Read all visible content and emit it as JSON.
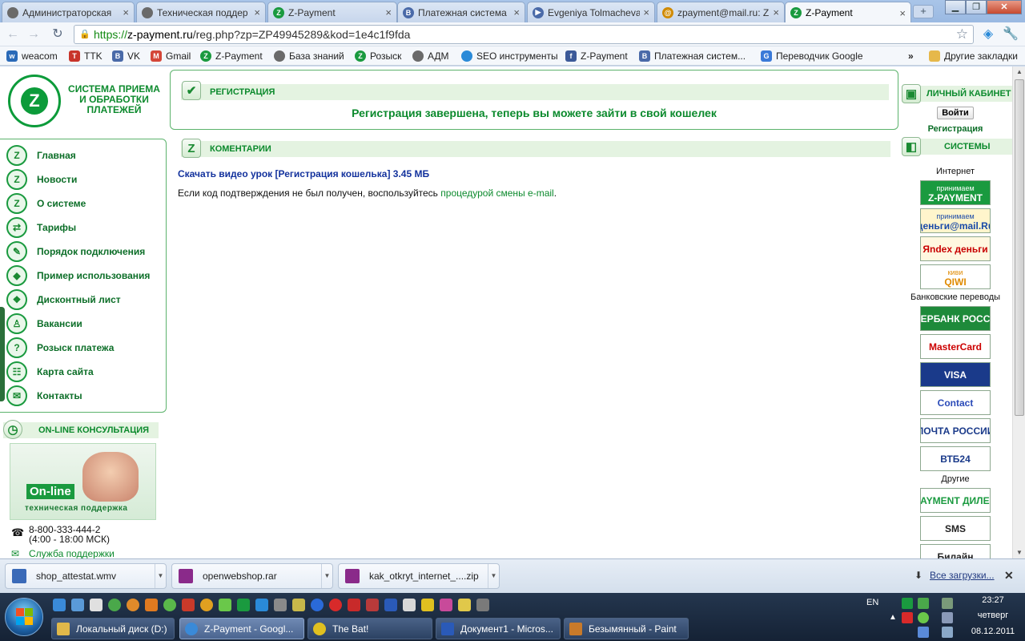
{
  "browser": {
    "tabs": [
      {
        "title": "Администраторская",
        "favicon_color": "#6a6a6a"
      },
      {
        "title": "Техническая поддер",
        "favicon_color": "#6a6a6a"
      },
      {
        "title": "Z-Payment",
        "favicon_color": "#1a9a3f"
      },
      {
        "title": "Платежная система",
        "favicon_color": "#4a6aa8"
      },
      {
        "title": "Evgeniya Tolmacheva",
        "favicon_color": "#4a6aa8"
      },
      {
        "title": "zpayment@mail.ru: Z",
        "favicon_color": "#d08a00"
      },
      {
        "title": "Z-Payment",
        "favicon_color": "#1a9a3f"
      }
    ],
    "new_tab_label": "+",
    "url_scheme": "https://",
    "url_host": "z-payment.ru",
    "url_path": "/reg.php?zp=ZP49945289&kod=1e4c1f9fda",
    "bookmarks": [
      {
        "label": "weacom",
        "icon": "w-icon",
        "color": "#2a6ab8"
      },
      {
        "label": "TTK",
        "icon": "ttk-icon",
        "color": "#c8342a"
      },
      {
        "label": "VK",
        "icon": "vk-icon",
        "color": "#4a6aa8"
      },
      {
        "label": "Gmail",
        "icon": "gmail-icon",
        "color": "#d44638"
      },
      {
        "label": "Z-Payment",
        "icon": "zpayment-icon",
        "color": "#1a9a3f"
      },
      {
        "label": "База знаний",
        "icon": "globe-icon",
        "color": "#6a6a6a"
      },
      {
        "label": "Розыск",
        "icon": "zpayment-icon",
        "color": "#1a9a3f"
      },
      {
        "label": "АДМ",
        "icon": "globe-icon",
        "color": "#6a6a6a"
      },
      {
        "label": "SEO инструменты",
        "icon": "seo-icon",
        "color": "#2a8ad8"
      },
      {
        "label": "Z-Payment",
        "icon": "facebook-icon",
        "color": "#3b5998"
      },
      {
        "label": "Платежная систем...",
        "icon": "vk-icon",
        "color": "#4a6aa8"
      },
      {
        "label": "Переводчик Google",
        "icon": "translate-icon",
        "color": "#3a7ad8"
      }
    ],
    "other_bookmarks": "Другие закладки"
  },
  "site": {
    "name": "СИСТЕМА ПРИЕМА И ОБРАБОТКИ ПЛАТЕЖЕЙ",
    "logo_letter": "Z",
    "nav": [
      {
        "label": "Главная",
        "icon": "home-icon"
      },
      {
        "label": "Новости",
        "icon": "news-icon"
      },
      {
        "label": "О системе",
        "icon": "info-icon"
      },
      {
        "label": "Тарифы",
        "icon": "tariff-icon"
      },
      {
        "label": "Порядок подключения",
        "icon": "pen-icon"
      },
      {
        "label": "Пример использования",
        "icon": "example-icon"
      },
      {
        "label": "Дисконтный лист",
        "icon": "gift-icon"
      },
      {
        "label": "Вакансии",
        "icon": "chair-icon"
      },
      {
        "label": "Розыск платежа",
        "icon": "question-icon"
      },
      {
        "label": "Карта сайта",
        "icon": "sitemap-icon"
      },
      {
        "label": "Контакты",
        "icon": "mail-icon"
      }
    ],
    "consult_title": "ON-LINE КОНСУЛЬТАЦИЯ",
    "consult_badge": "On-line",
    "consult_sub": "техническая поддержка",
    "phone": "8-800-333-444-2",
    "phone_hours": "(4:00 - 18:00 МСК)",
    "support_link": "Служба поддержки",
    "registration_title": "РЕГИСТРАЦИЯ",
    "registration_message": "Регистрация завершена, теперь вы можете зайти в свой кошелек",
    "comments_title": "КОМЕНТАРИИ",
    "download_link": "Скачать видео урок",
    "download_name": "[Регистрация кошелька]",
    "download_size": "3.45 МБ",
    "note_text": "Если код подтверждения не был получен, воспользуйтесь ",
    "note_link": "процедурой смены e-mail",
    "note_end": ".",
    "cabinet_title": "ЛИЧНЫЙ КАБИНЕТ",
    "login_button": "Войти",
    "register_link": "Регистрация",
    "systems_title": "СИСТЕМЫ",
    "section_internet": "Интернет",
    "section_bank": "Банковские переводы",
    "section_other": "Другие",
    "systems": [
      {
        "label": "Z-PAYMENT",
        "sub": "принимаем",
        "color": "#1a9a3f",
        "text_color": "#ffffff"
      },
      {
        "label": "деньги@mail.Ru",
        "sub": "принимаем",
        "color": "#fff5cc",
        "text_color": "#1a4aa8"
      },
      {
        "label": "Яndex деньги",
        "sub": "",
        "color": "#fff8e0",
        "text_color": "#c80000"
      },
      {
        "label": "QIWI",
        "sub": "киви",
        "color": "#ffffff",
        "text_color": "#e08a00"
      },
      {
        "label": "СБЕРБАНК РОССИИ",
        "sub": "",
        "color": "#1e8a3a",
        "text_color": "#ffffff"
      },
      {
        "label": "MasterCard",
        "sub": "",
        "color": "#ffffff",
        "text_color": "#cc0000"
      },
      {
        "label": "VISA",
        "sub": "",
        "color": "#1a3a8a",
        "text_color": "#ffffff"
      },
      {
        "label": "Contact",
        "sub": "",
        "color": "#ffffff",
        "text_color": "#2a4ab8"
      },
      {
        "label": "ПОЧТА РОССИИ",
        "sub": "",
        "color": "#ffffff",
        "text_color": "#1a3a8a"
      },
      {
        "label": "ВТБ24",
        "sub": "",
        "color": "#ffffff",
        "text_color": "#1a3a8a"
      },
      {
        "label": "Z-PAYMENT ДИЛЕРЫ",
        "sub": "",
        "color": "#ffffff",
        "text_color": "#1a9a3f"
      },
      {
        "label": "SMS",
        "sub": "",
        "color": "#ffffff",
        "text_color": "#222222"
      },
      {
        "label": "Билайн",
        "sub": "",
        "color": "#ffffff",
        "text_color": "#222222"
      }
    ]
  },
  "downloads": [
    {
      "name": "shop_attestat.wmv",
      "icon": "video-icon",
      "color": "#3a6ab8"
    },
    {
      "name": "openwebshop.rar",
      "icon": "archive-icon",
      "color": "#8a2a8a"
    },
    {
      "name": "kak_otkryt_internet_....zip",
      "icon": "archive-icon",
      "color": "#8a2a8a"
    }
  ],
  "all_downloads": "Все загрузки...",
  "taskbar": {
    "windows": [
      {
        "label": "Локальный диск (D:)",
        "color": "#e0b84a"
      },
      {
        "label": "Z-Payment - Googl...",
        "color": "#3a8ad8"
      },
      {
        "label": "The Bat!",
        "color": "#e0c020"
      },
      {
        "label": "Документ1 - Micros...",
        "color": "#2a5ab8"
      },
      {
        "label": "Безымянный - Paint",
        "color": "#c87a2a"
      }
    ],
    "lang": "EN",
    "time": "23:27",
    "day": "четверг",
    "date": "08.12.2011"
  }
}
